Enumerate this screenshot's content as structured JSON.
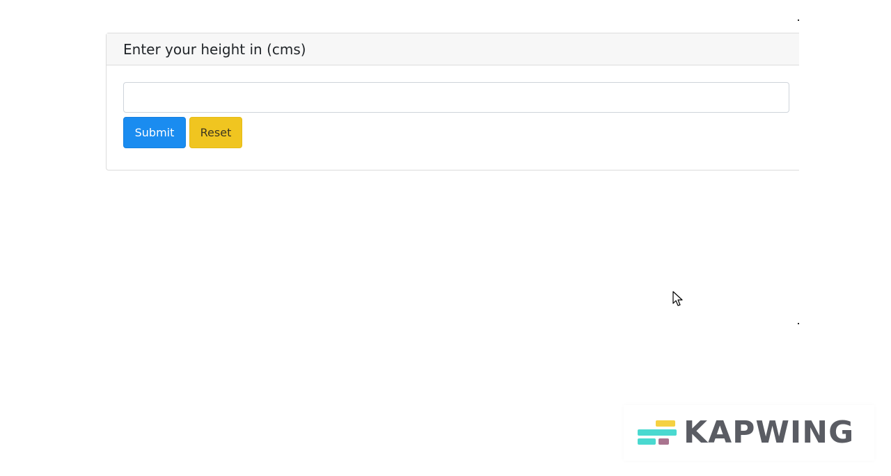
{
  "form": {
    "title": "Enter your height in (cms)",
    "height_value": "",
    "height_placeholder": "",
    "submit_label": "Submit",
    "reset_label": "Reset"
  },
  "colors": {
    "submit_bg": "#1a8cf0",
    "reset_bg": "#f0c520",
    "header_bg": "#f7f7f7"
  },
  "watermark": {
    "brand": "KAPWING",
    "logo_icon": "kapwing-logo-icon"
  },
  "cursor": {
    "icon": "mouse-pointer-icon"
  }
}
